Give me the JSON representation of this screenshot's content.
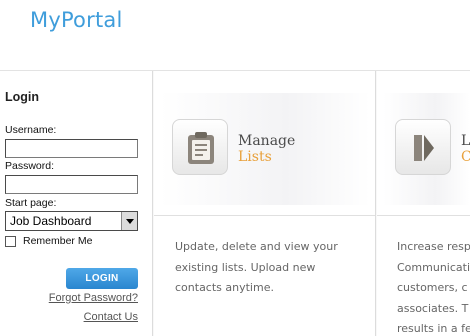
{
  "header": {
    "logo": "MyPortal"
  },
  "login": {
    "title": "Login",
    "username_label": "Username:",
    "username_value": "",
    "password_label": "Password:",
    "password_value": "",
    "start_page_label": "Start page:",
    "start_page_value": "Job Dashboard",
    "remember_label": "Remember Me",
    "remember_checked": false,
    "login_button": "LOGIN",
    "forgot_link": "Forgot Password?",
    "contact_link": "Contact Us"
  },
  "features": [
    {
      "icon": "clipboard-list-icon",
      "title_line1": "Manage",
      "title_line2": "Lists",
      "desc": [
        "Update, delete and view your",
        "existing lists. Upload new",
        "contacts anytime."
      ]
    },
    {
      "icon": "arrows-right-icon",
      "title_line1": "La",
      "title_line2": "Ca",
      "desc": [
        "Increase resp",
        "Communicatio",
        "customers, c",
        "associates. T",
        "results in a fe"
      ]
    }
  ],
  "colors": {
    "logo": "#3f9ddb",
    "button": "#2a86cf",
    "accent_title": "#e8a03a"
  }
}
